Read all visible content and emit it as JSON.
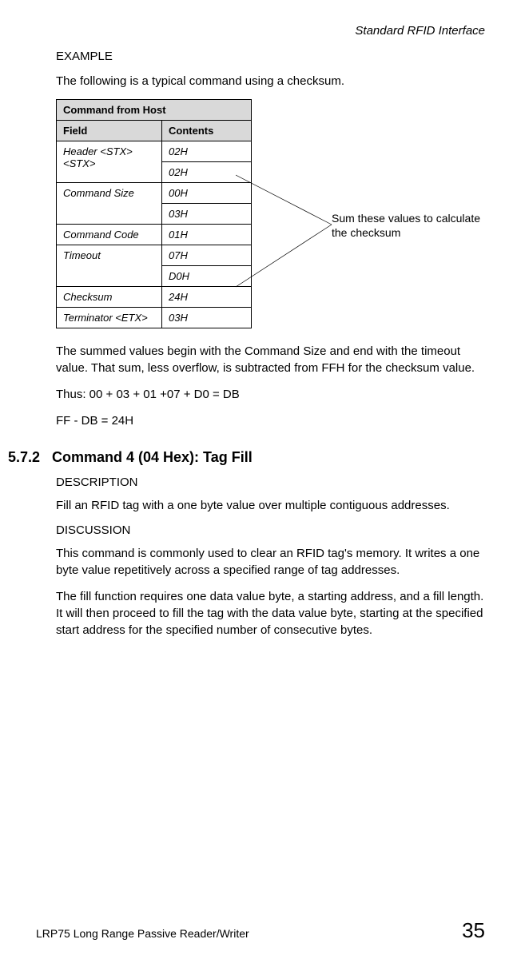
{
  "header": {
    "chapter": "Standard RFID Interface"
  },
  "example": {
    "label": "EXAMPLE",
    "intro": "The following is a typical command using a checksum."
  },
  "table": {
    "title": "Command from Host",
    "col_field": "Field",
    "col_contents": "Contents",
    "rows": {
      "header_field": "Header <STX><STX>",
      "header_c1": "02H",
      "header_c2": "02H",
      "cmdsize_field": "Command Size",
      "cmdsize_c1": "00H",
      "cmdsize_c2": "03H",
      "cmdcode_field": "Command Code",
      "cmdcode_c1": "01H",
      "timeout_field": "Timeout",
      "timeout_c1": "07H",
      "timeout_c2": "D0H",
      "checksum_field": "Checksum",
      "checksum_c1": "24H",
      "terminator_field": "Terminator <ETX>",
      "terminator_c1": "03H"
    }
  },
  "callout": "Sum these values to calculate the checksum",
  "post_table": {
    "p1": "The summed values begin with the Command Size and end with the timeout value. That sum, less overflow, is subtracted from FFH for the checksum value.",
    "p2": "Thus: 00 + 03 + 01 +07 + D0 = DB",
    "p3": "FF - DB = 24H"
  },
  "section": {
    "num": "5.7.2",
    "title": "Command 4 (04 Hex): Tag Fill",
    "desc_label": "DESCRIPTION",
    "desc_text": "Fill an RFID tag with a one byte value over multiple contiguous addresses.",
    "disc_label": "DISCUSSION",
    "disc_p1": "This command is commonly used to clear an RFID tag's memory. It writes a one byte value repetitively across a specified range of tag addresses.",
    "disc_p2": "The fill function requires one data value byte, a starting address, and a fill length. It will then proceed to fill the tag with the data value byte, starting at the specified start address for the specified number of consecutive bytes."
  },
  "footer": {
    "doc": "LRP75 Long Range Passive Reader/Writer",
    "page": "35"
  }
}
